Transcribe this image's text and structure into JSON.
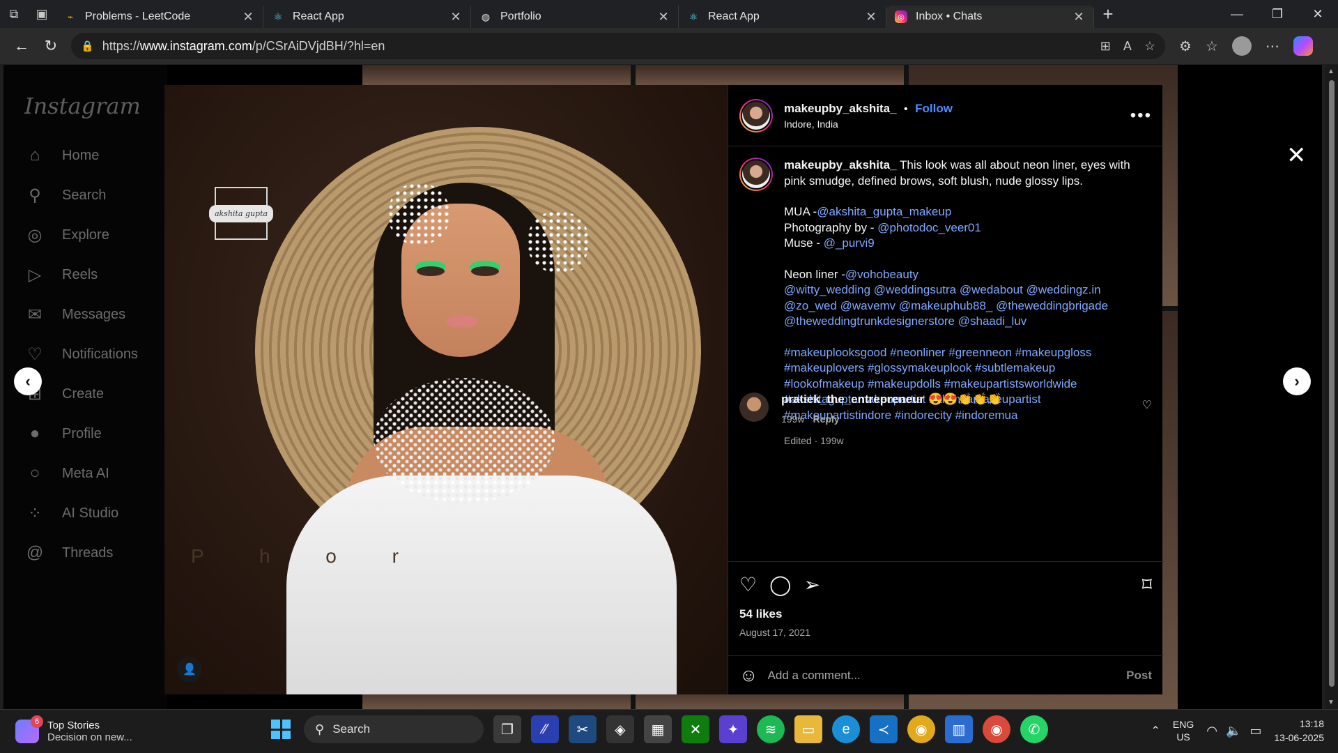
{
  "browser": {
    "tabs": [
      {
        "title": "Problems - LeetCode",
        "icon": "leetcode-icon"
      },
      {
        "title": "React App",
        "icon": "react-icon"
      },
      {
        "title": "Portfolio",
        "icon": "globe-icon"
      },
      {
        "title": "React App",
        "icon": "react-icon"
      },
      {
        "title": "Inbox • Chats",
        "icon": "instagram-icon"
      }
    ],
    "url_prefix": "https://",
    "url_domain": "www.instagram.com",
    "url_path": "/p/CSrAiDVjdBH/?hl=en"
  },
  "sidebar": {
    "logo": "Instagram",
    "items": [
      {
        "label": "Home",
        "icon": "home-icon"
      },
      {
        "label": "Search",
        "icon": "search-icon"
      },
      {
        "label": "Explore",
        "icon": "explore-icon"
      },
      {
        "label": "Reels",
        "icon": "reels-icon"
      },
      {
        "label": "Messages",
        "icon": "messages-icon"
      },
      {
        "label": "Notifications",
        "icon": "heart-icon"
      },
      {
        "label": "Create",
        "icon": "plus-square-icon"
      },
      {
        "label": "Profile",
        "icon": "profile-avatar"
      },
      {
        "label": "Meta AI",
        "icon": "meta-ai-icon"
      },
      {
        "label": "AI Studio",
        "icon": "ai-studio-icon"
      },
      {
        "label": "Threads",
        "icon": "threads-icon"
      }
    ]
  },
  "post": {
    "image_watermark": "akshita gupta",
    "image_text": "P h o                                    r",
    "header": {
      "username": "makeupby_akshita_",
      "dot": "•",
      "follow": "Follow",
      "location": "Indore, India"
    },
    "caption": {
      "username": "makeupby_akshita_",
      "text": "This look was all about neon liner, eyes with pink smudge, defined brows, soft blush, nude glossy lips.",
      "credits": [
        {
          "label": "MUA -",
          "handle": "@akshita_gupta_makeup"
        },
        {
          "label": "Photography by - ",
          "handle": "@photodoc_veer01"
        },
        {
          "label": "Muse - ",
          "handle": "@_purvi9"
        }
      ],
      "liner_label": "Neon liner -",
      "liner_handle": "@vohobeauty",
      "mentions": [
        "@witty_wedding @weddingsutra @wedabout @weddingz.in",
        "@zo_wed @wavemv @makeuphub88_ @theweddingbrigade",
        "@theweddingtrunkdesignerstore @shaadi_luv"
      ],
      "hashtags": [
        "#makeuplooksgood #neonliner #greenneon #makeupgloss",
        "#makeuplovers #glossymakeuplook #subtlemakeup",
        "#lookofmakeup #makeupdolls #makeupartistsworldwide",
        "#akshitaguptamakeupartist #akshitamakeupartist",
        "#makeupartistindore #indorecity #indoremua"
      ],
      "meta": "Edited · 199w"
    },
    "comment": {
      "username": "pratiek_the_entrepreneur",
      "text": "😍😍👏👏👏",
      "age": "199w",
      "reply": "Reply"
    },
    "likes": "54 likes",
    "date": "August 17, 2021",
    "add_comment_placeholder": "Add a comment...",
    "post_button": "Post"
  },
  "taskbar": {
    "news_title": "Top Stories",
    "news_sub": "Decision on new...",
    "news_badge": "6",
    "search_label": "Search",
    "lang_top": "ENG",
    "lang_bottom": "US",
    "time": "13:18",
    "date": "13-06-2025"
  }
}
